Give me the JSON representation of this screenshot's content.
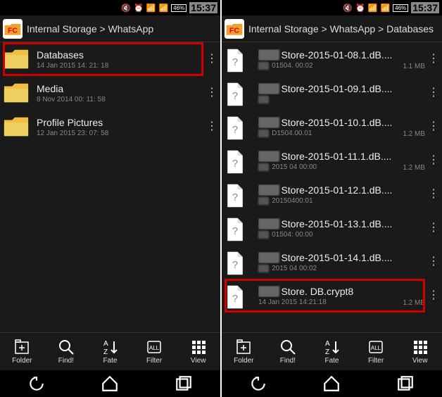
{
  "status": {
    "battery": "46%",
    "clock": "15:37"
  },
  "left": {
    "breadcrumb": "Internal Storage > WhatsApp",
    "items": [
      {
        "type": "folder",
        "name": "Databases",
        "date": "14 Jan 2015 14: 21: 18",
        "highlighted": true
      },
      {
        "type": "folder",
        "name": "Media",
        "date": "8 Nov 2014 00: 11: 58"
      },
      {
        "type": "folder",
        "name": "Profile Pictures",
        "date": "12 Jan 2015 23: 07: 58"
      }
    ]
  },
  "right": {
    "breadcrumb": "Internal Storage > WhatsApp > Databases",
    "items": [
      {
        "type": "file",
        "blurprefix": "msg",
        "name": "Store-2015-01-08.1.dB....",
        "blurmeta": "20",
        "date": "01504. 00:02",
        "size": "1.1 MB"
      },
      {
        "type": "file",
        "blurprefix": "msg",
        "name": "Store-2015-01-09.1.dB....",
        "blurmeta": "20",
        "date": "",
        "size": ""
      },
      {
        "type": "file",
        "blurprefix": "msg",
        "name": "Store-2015-01-10.1.dB....",
        "blurmeta": "20",
        "date": "D1504.00.01",
        "size": "1.2 MB"
      },
      {
        "type": "file",
        "blurprefix": "msg",
        "name": "Store-2015-01-11.1.dB....",
        "blurmeta": "20",
        "date": "2015 04 00:00",
        "size": "1.2 MB"
      },
      {
        "type": "file",
        "blurprefix": "msg",
        "name": "Store-2015-01-12.1.dB....",
        "blurmeta": "20",
        "date": "20150400:01",
        "size": ""
      },
      {
        "type": "file",
        "blurprefix": "msg",
        "name": "Store-2015-01-13.1.dB....",
        "blurmeta": "20",
        "date": "01504: 00:00",
        "size": ""
      },
      {
        "type": "file",
        "blurprefix": "msg",
        "name": "Store-2015-01-14.1.dB....",
        "blurmeta": "20",
        "date": "2015 04 00:02",
        "size": ""
      },
      {
        "type": "file",
        "blurprefix": "msg",
        "name": "Store. DB.crypt8",
        "blurmeta": "",
        "date": "14 Jan 2015 14:21:18",
        "size": "1.2 MB",
        "highlighted": true
      }
    ]
  },
  "toolbar": {
    "folder": "Folder",
    "find": "Find!",
    "fate": "Fate",
    "filter": "Filter",
    "view": "View"
  }
}
